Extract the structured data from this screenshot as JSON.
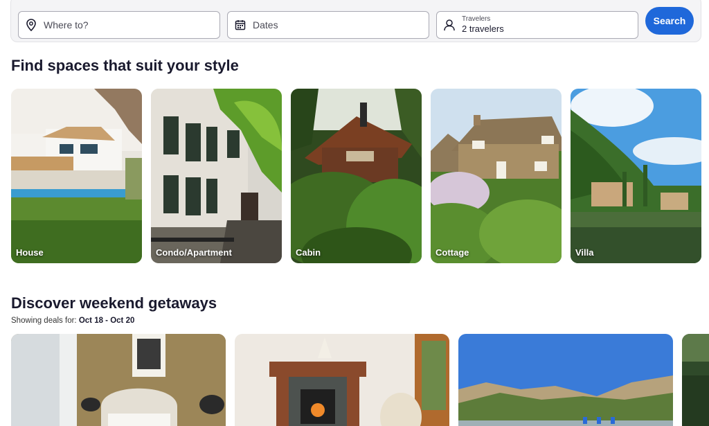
{
  "search": {
    "where_placeholder": "Where to?",
    "dates_placeholder": "Dates",
    "travelers_label": "Travelers",
    "travelers_value": "2 travelers",
    "search_button": "Search"
  },
  "styles_section": {
    "title": "Find spaces that suit your style",
    "cards": [
      {
        "label": "House"
      },
      {
        "label": "Condo/Apartment"
      },
      {
        "label": "Cabin"
      },
      {
        "label": "Cottage"
      },
      {
        "label": "Villa"
      }
    ]
  },
  "getaways_section": {
    "title": "Discover weekend getaways",
    "deals_prefix": "Showing deals for:",
    "deals_dates": "Oct 18 - Oct 20"
  },
  "colors": {
    "accent": "#1f68da",
    "text": "#1a1a2e"
  }
}
